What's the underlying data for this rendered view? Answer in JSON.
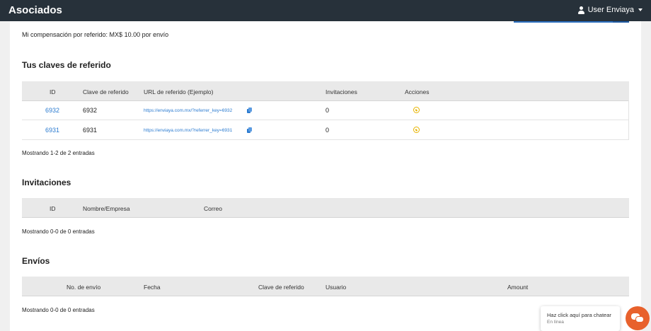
{
  "header": {
    "title": "Asociados",
    "user_name": "User Enviaya"
  },
  "compensation_text": "Mi compensación por referido: MX$ 10.00 por envío",
  "referral_keys": {
    "title": "Tus claves de referido",
    "columns": [
      "ID",
      "Clave de referido",
      "URL de referido (Ejemplo)",
      "Invitaciones",
      "Acciones"
    ],
    "rows": [
      {
        "id": "6932",
        "key": "6932",
        "url": "https://enviaya.com.mx/?referrer_key=6932",
        "invitations": "0"
      },
      {
        "id": "6931",
        "key": "6931",
        "url": "https://enviaya.com.mx/?referrer_key=6931",
        "invitations": "0"
      }
    ],
    "footer": "Mostrando 1-2 de 2 entradas"
  },
  "invitations": {
    "title": "Invitaciones",
    "columns": [
      "ID",
      "Nombre/Empresa",
      "Correo"
    ],
    "footer": "Mostrando 0-0 de 0 entradas"
  },
  "shipments": {
    "title": "Envíos",
    "columns": [
      "No. de envío",
      "Fecha",
      "Clave de referido",
      "Usuario",
      "Amount"
    ],
    "footer": "Mostrando 0-0 de 0 entradas"
  },
  "chat": {
    "title": "Haz click aquí para chatear",
    "status": "En línea"
  },
  "colors": {
    "topbar": "#27313a",
    "link": "#2b7bd0",
    "action_icon": "#e8b400",
    "chat_button": "#e8612c"
  },
  "icons": [
    "user-icon",
    "chevron-down-icon",
    "copy-icon",
    "ban-icon",
    "chat-icon"
  ]
}
